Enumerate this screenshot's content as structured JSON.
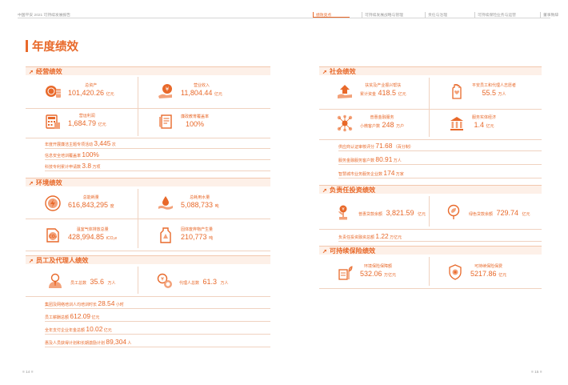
{
  "header": {
    "doc_title": "中国平安 2021 可持续发展报告",
    "nav": [
      "绩效亮点",
      "可持续发展战略与管理",
      "责任与治理",
      "可持续保险业务与运营",
      "董事致辞"
    ],
    "active_index": 0
  },
  "page_title": "年度绩效",
  "left": {
    "business": {
      "title": "经营绩效",
      "cards": [
        {
          "label": "总资产",
          "value": "101,420.26",
          "unit": "亿元",
          "icon": "coins-icon"
        },
        {
          "label": "营业收入",
          "value": "11,804.44",
          "unit": "亿元",
          "icon": "money-hand-icon"
        },
        {
          "label": "营运利润",
          "value": "1,684.79",
          "unit": "亿元",
          "icon": "calculator-icon"
        },
        {
          "label": "廉政教育覆盖率",
          "value": "100%",
          "unit": "",
          "icon": "document-icon"
        }
      ],
      "lines": [
        {
          "label": "年度开展廉洁主题专项活动",
          "value": "3,445",
          "unit": "次"
        },
        {
          "label": "信息安全培训覆盖率",
          "value": "100%",
          "unit": ""
        },
        {
          "label": "科技专利累计申请数",
          "value": "3.8",
          "unit": "万项"
        }
      ]
    },
    "environment": {
      "title": "环境绩效",
      "cards": [
        {
          "label": "总能耗量",
          "value": "616,843,295",
          "unit": "度",
          "icon": "energy-icon"
        },
        {
          "label": "总耗用水量",
          "value": "5,088,733",
          "unit": "吨",
          "icon": "water-hand-icon"
        },
        {
          "label": "温室气体排放总量",
          "value": "428,994.85",
          "unit": "tCO₂e",
          "icon": "co2-icon"
        },
        {
          "label": "固体废弃物产生量",
          "value": "210,773",
          "unit": "吨",
          "icon": "waste-icon"
        }
      ]
    },
    "employee": {
      "title": "员工及代理人绩效",
      "cards": [
        {
          "label": "员工总数",
          "value": "35.6",
          "unit": "万人",
          "icon": "employee-icon"
        },
        {
          "label": "代理人总数",
          "value": "61.3",
          "unit": "万人",
          "icon": "agent-icon"
        }
      ],
      "lines": [
        {
          "label": "集团及网络培训人均培训时长",
          "value": "28.54",
          "unit": "小时"
        },
        {
          "label": "员工薪酬总额",
          "value": "612.09",
          "unit": "亿元"
        },
        {
          "label": "全年支付企业年金总额",
          "value": "10.02",
          "unit": "亿元"
        },
        {
          "label": "惠及人员获得计划和长期激励计划",
          "value": "89,304",
          "unit": "人"
        }
      ]
    }
  },
  "right": {
    "social": {
      "title": "社会绩效",
      "cards": [
        {
          "label": "扶贫及产业振兴帮扶",
          "label2": "累计资金",
          "value": "418.5",
          "unit": "亿元",
          "icon": "poverty-help-icon"
        },
        {
          "label": "平安员工和代理人志愿者",
          "value": "55.5",
          "unit": "万人",
          "icon": "volunteer-hand-icon"
        },
        {
          "label": "普惠金融服务",
          "label2": "小微客户数",
          "value": "248",
          "unit": "万户",
          "icon": "network-icon"
        },
        {
          "label": "服务实体经济",
          "label2": "",
          "value": "1.4",
          "unit": "亿元",
          "icon": "building-icon"
        }
      ],
      "lines": [
        {
          "label": "供应商认证审核评分",
          "value": "71.68",
          "unit": "（百分制）"
        },
        {
          "label": "服务金融服务客户数",
          "value": "80.91",
          "unit": "万人"
        },
        {
          "label": "智慧城市业务服务企业数",
          "value": "174",
          "unit": "万家"
        }
      ]
    },
    "investment": {
      "title": "负责任投资绩效",
      "cards": [
        {
          "label": "普惠贷款余额",
          "value": "3,821.59",
          "unit": "亿元",
          "icon": "plant-coin-icon"
        },
        {
          "label": "绿色贷款余额",
          "value": "729.74",
          "unit": "亿元",
          "icon": "leaf-icon"
        }
      ],
      "lines": [
        {
          "label": "负责任投资融资总额",
          "value": "1.22",
          "unit": "万亿元"
        }
      ]
    },
    "insurance": {
      "title": "可持续保险绩效",
      "cards": [
        {
          "label": "环境保险保障额",
          "value": "532.06",
          "unit": "万亿元",
          "icon": "insurance-plant-icon"
        },
        {
          "label": "可持续保险保费",
          "value": "5217.86",
          "unit": "亿元",
          "icon": "shield-flower-icon"
        }
      ]
    }
  },
  "footer": {
    "left": "≡ 14 ≡",
    "right": "≡ 15 ≡"
  },
  "colors": {
    "accent": "#e8692a",
    "band": "#fdf0e8"
  }
}
